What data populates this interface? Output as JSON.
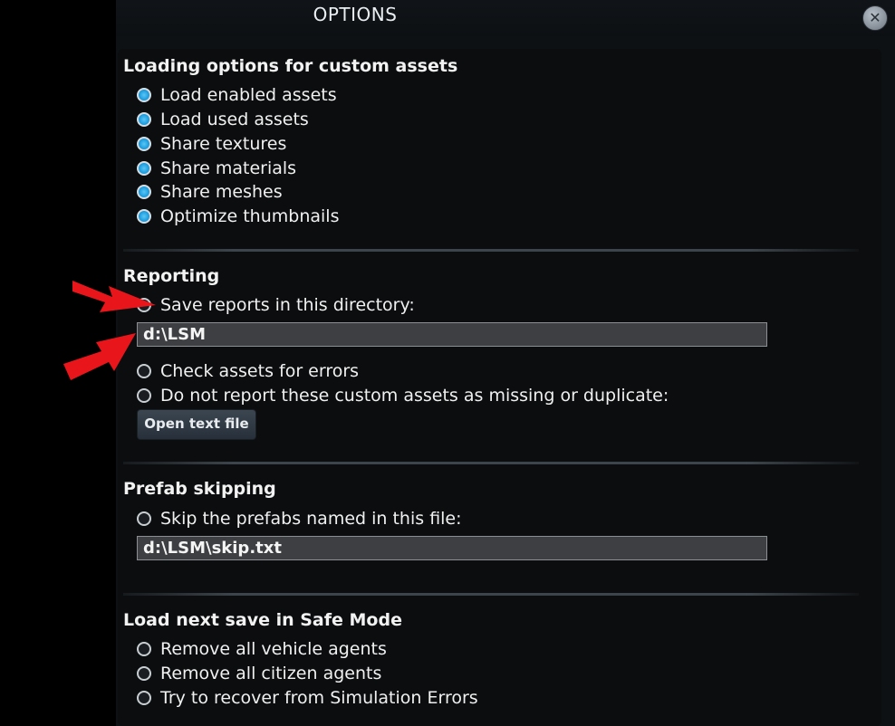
{
  "window": {
    "title": "OPTIONS",
    "close_icon": "close-icon"
  },
  "sections": {
    "loading": {
      "title": "Loading options for custom assets",
      "options": [
        {
          "label": "Load enabled assets",
          "checked": true
        },
        {
          "label": "Load used assets",
          "checked": true
        },
        {
          "label": "Share textures",
          "checked": true
        },
        {
          "label": "Share materials",
          "checked": true
        },
        {
          "label": "Share meshes",
          "checked": true
        },
        {
          "label": "Optimize thumbnails",
          "checked": true
        }
      ]
    },
    "reporting": {
      "title": "Reporting",
      "save_reports": {
        "label": "Save reports in this directory:",
        "checked": false
      },
      "directory_value": "d:\\LSM",
      "check_assets": {
        "label": "Check assets for errors",
        "checked": false
      },
      "do_not_report": {
        "label": "Do not report these custom assets as missing or duplicate:",
        "checked": false
      },
      "open_text_file_label": "Open text file"
    },
    "prefab": {
      "title": "Prefab skipping",
      "skip_prefabs": {
        "label": "Skip the prefabs named in this file:",
        "checked": false
      },
      "file_value": "d:\\LSM\\skip.txt"
    },
    "safe_mode": {
      "title": "Load next save in Safe Mode",
      "options": [
        {
          "label": "Remove all vehicle agents",
          "checked": false
        },
        {
          "label": "Remove all citizen agents",
          "checked": false
        },
        {
          "label": "Try to recover from Simulation Errors",
          "checked": false
        }
      ]
    }
  },
  "annotations": {
    "arrow_color": "#e8151b"
  },
  "colors": {
    "accent_radio": "#1d9ee0",
    "background": "#0b0d0f"
  }
}
